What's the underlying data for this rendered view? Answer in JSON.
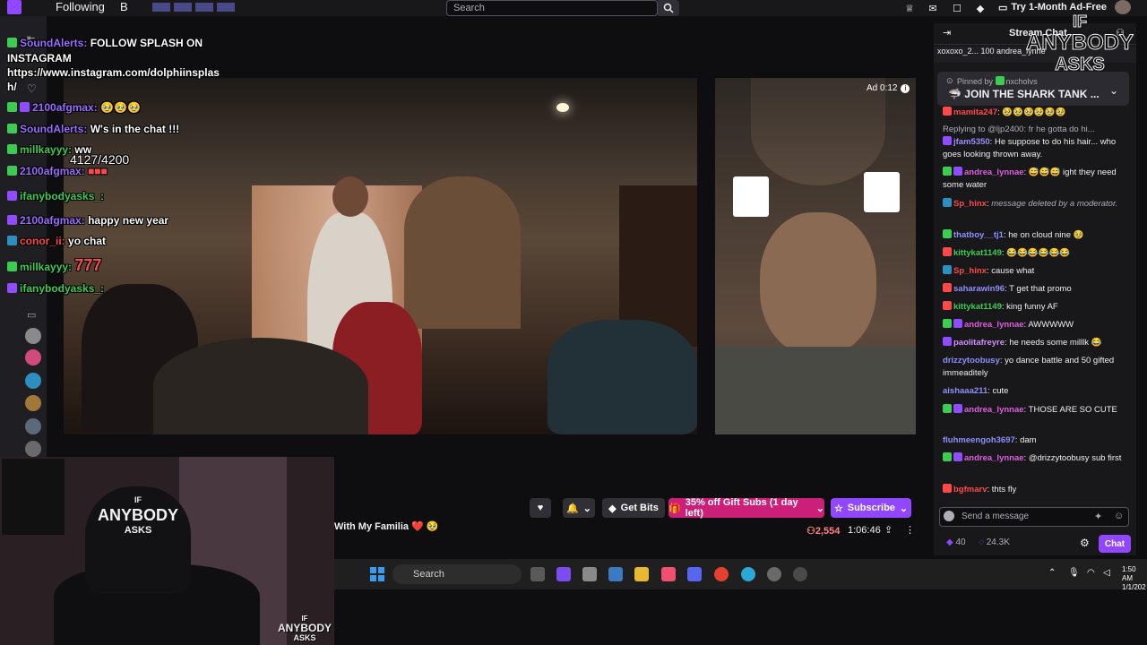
{
  "nav": {
    "following": "Following",
    "browse": "B",
    "search_placeholder": "Search",
    "ad_free": "Try 1-Month Ad-Free"
  },
  "overlay_chat": [
    {
      "user": "SoundAlerts:",
      "text": "FOLLOW SPLASH ON"
    },
    {
      "text": "INSTAGRAM"
    },
    {
      "text": "https://www.instagram.com/dolphiinsplas"
    },
    {
      "text": "h/"
    },
    {
      "user": "2100afgmax:",
      "text": "🥹🥹🥹"
    },
    {
      "user": "SoundAlerts:",
      "text": "W's in the chat !!!"
    },
    {
      "user": "millkayyy:",
      "text": "ww"
    },
    {
      "user": "2100afgmax:",
      "text": ""
    },
    {
      "user": "ifanybodyasks_:",
      "text": ""
    },
    {
      "user": "2100afgmax:",
      "text": "happy new year"
    },
    {
      "user": "conor_ii:",
      "text": "yo chat"
    },
    {
      "user": "millkayyy:",
      "text": "777"
    },
    {
      "user": "ifanybodyasks_:",
      "text": ""
    }
  ],
  "goal_counter": "4127/4200",
  "ad": {
    "label": "Ad 0:12"
  },
  "watermark": {
    "line1": "IF",
    "line2": "ANYBODY",
    "line3": "ASKS"
  },
  "hood": {
    "line1": "IF",
    "line2": "ANYBODY",
    "line3": "ASKS"
  },
  "stream": {
    "title": "With My Familia ❤️ 🥹",
    "viewers": "2,554",
    "uptime": "1:06:46",
    "get_bits": "Get Bits",
    "gift_subs": "35% off Gift Subs (1 day left)",
    "subscribe": "Subscribe"
  },
  "taskbar": {
    "search": "Search",
    "time": "1:50 AM",
    "date": "1/1/202"
  },
  "chat": {
    "title": "Stream Chat",
    "gift_bar": "xoxoxo_2...   100   andrea_lynne",
    "pinned_by": "Pinned by",
    "pinned_user": "nxcholvs",
    "pinned_msg": "🦈 JOIN THE SHARK TANK ...",
    "messages": [
      {
        "user": "mamita247",
        "color": "#ff4848",
        "text": "🥹🥹🥹🥹🥹🥹"
      },
      {
        "user": "",
        "color": "#adadb8",
        "text": "Replying to @ljp2400: fr he gotta do hi..."
      },
      {
        "user": "jfam5350",
        "color": "#9b8cff",
        "text": "He suppose to do his hair... who goes looking thrown away."
      },
      {
        "user": "andrea_lynnae",
        "color": "#e05ce0",
        "text": "😅😅😅 ight they need some water"
      },
      {
        "user": "Sp_hinx",
        "color": "#ff4848",
        "text": "message deleted by a moderator."
      },
      {
        "user": "thatboy__tj1",
        "color": "#8f8fff",
        "text": "he on cloud nine 🥹"
      },
      {
        "user": "kittykat1149",
        "color": "#3dcc52",
        "text": "😂😂😂😂😂😂"
      },
      {
        "user": "Sp_hinx",
        "color": "#ff4848",
        "text": "cause what"
      },
      {
        "user": "saharawin96",
        "color": "#8f8fff",
        "text": "T get that promo"
      },
      {
        "user": "kittykat1149",
        "color": "#3dcc52",
        "text": "king funny AF"
      },
      {
        "user": "andrea_lynnae",
        "color": "#e05ce0",
        "text": "AWWWWW"
      },
      {
        "user": "paolitafreyre",
        "color": "#d48cff",
        "text": "he needs some milllk 😂"
      },
      {
        "user": "drizzytoobusy",
        "color": "#8f8fff",
        "text": "yo dance battle and 50 gifted immeaditely"
      },
      {
        "user": "aishaaa211",
        "color": "#8f8fff",
        "text": "cute"
      },
      {
        "user": "andrea_lynnae",
        "color": "#e05ce0",
        "text": "THOSE ARE SO CUTE"
      },
      {
        "user": "fluhmeengoh3697",
        "color": "#8f8fff",
        "text": "dam"
      },
      {
        "user": "andrea_lynnae",
        "color": "#e05ce0",
        "text": "@drizzytoobusy sub first"
      },
      {
        "user": "bgfmarv",
        "color": "#ff4848",
        "text": "thts fly"
      }
    ],
    "input_placeholder": "Send a message",
    "bits": "40",
    "points": "24.3K",
    "chat_button": "Chat"
  }
}
